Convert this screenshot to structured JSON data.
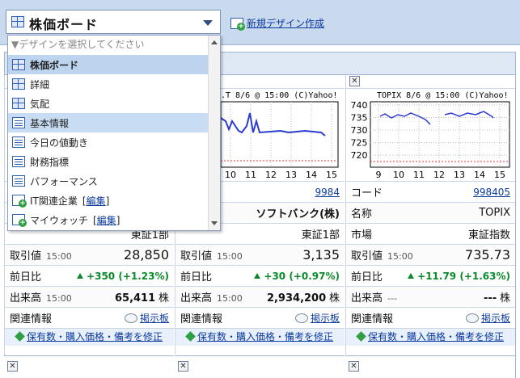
{
  "header": {
    "selected_design": "株価ボード",
    "new_design_link": "新規デザイン作成"
  },
  "dropdown": {
    "hint": "▼デザインを選択してください",
    "items": [
      {
        "label": "株価ボード",
        "icon": "grid-icon"
      },
      {
        "label": "詳細",
        "icon": "grid-icon"
      },
      {
        "label": "気配",
        "icon": "grid-icon"
      },
      {
        "label": "基本情報",
        "icon": "list-icon"
      },
      {
        "label": "今日の値動き",
        "icon": "list-icon"
      },
      {
        "label": "財務指標",
        "icon": "list-icon"
      },
      {
        "label": "パフォーマンス",
        "icon": "list-icon"
      },
      {
        "label": "IT関連企業",
        "link": "編集",
        "icon": "add-list-icon"
      },
      {
        "label": "マイウォッチ",
        "link": "編集",
        "icon": "add-list-icon"
      }
    ]
  },
  "panels": [
    {
      "close": "✕",
      "chart_title": "",
      "code_label": "",
      "code": "",
      "name_label": "",
      "name": "",
      "market": "東証1部",
      "price_label": "取引値",
      "price_time": "15:00",
      "price": "28,850",
      "change_label": "前日比",
      "change": "+350",
      "change_pct": "(+1.23%)",
      "volume_label": "出来高",
      "volume_time": "15:00",
      "volume": "65,411",
      "unit": "株",
      "related_label": "関連情報",
      "bbs": "掲示板",
      "edit": "保有数・購入価格・備考を修正"
    },
    {
      "close": "✕",
      "chart_title": ".T 8/6 @ 15:00 (C)Yahoo!",
      "code_label": "",
      "code": "9984",
      "name_label": "",
      "name": "ソフトバンク(株)",
      "market": "東証1部",
      "price_label": "取引値",
      "price_time": "15:00",
      "price": "3,135",
      "change_label": "前日比",
      "change": "+30",
      "change_pct": "(+0.97%)",
      "volume_label": "出来高",
      "volume_time": "15:00",
      "volume": "2,934,200",
      "unit": "株",
      "related_label": "関連情報",
      "bbs": "掲示板",
      "edit": "保有数・購入価格・備考を修正"
    },
    {
      "close": "✕",
      "chart_title": "TOPIX 8/6 @ 15:00 (C)Yahoo!",
      "code_label": "コード",
      "code": "998405",
      "name_label": "名称",
      "name": "TOPIX",
      "market_label": "市場",
      "market": "東証指数",
      "price_label": "取引値",
      "price_time": "15:00",
      "price": "735.73",
      "change_label": "前日比",
      "change": "+11.79",
      "change_pct": "(+1.63%)",
      "volume_label": "出来高",
      "volume_time": "---",
      "volume": "---",
      "unit": "株",
      "related_label": "関連情報",
      "bbs": "掲示板",
      "edit": "保有数・購入価格・備考を修正"
    }
  ],
  "charts": [
    {
      "x_ticks": [
        "10",
        "11",
        "12",
        "13",
        "14",
        "15"
      ],
      "y_ticks": []
    },
    {
      "x_ticks": [
        "9",
        "10",
        "11",
        "12",
        "13",
        "14",
        "15"
      ],
      "y_ticks": [
        "740",
        "735",
        "730",
        "725",
        "720"
      ]
    }
  ],
  "bottom_close": "✕",
  "colors": {
    "accent": "#0b3a9e",
    "up": "#0a8a2a",
    "selected": "#bcd4ee"
  }
}
